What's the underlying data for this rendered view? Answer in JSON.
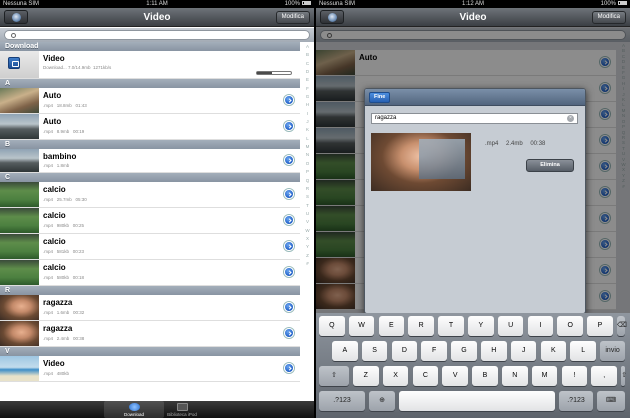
{
  "status": {
    "carrier": "Nessuna SIM",
    "time": "1:11 AM",
    "battery": "100%"
  },
  "status_right": {
    "carrier": "Nessuna SIM",
    "time": "1:12 AM",
    "battery": "100%"
  },
  "navbar": {
    "title": "Video",
    "edit_label": "Modifica"
  },
  "navbar_right": {
    "title": "Video",
    "edit_label": "Modifica"
  },
  "search": {
    "value": ""
  },
  "sections": {
    "download": "Download",
    "a": "A",
    "b": "B",
    "c": "C",
    "r": "R",
    "v": "V"
  },
  "rows": [
    {
      "title": "Video",
      "sub": "Download... 7.0/14.9mb  1271kb/s",
      "progress": 0.45
    },
    {
      "title": "Auto",
      "sub": ".mp4   18.8mb   01:43"
    },
    {
      "title": "Auto",
      "sub": ".mp4   8.9mb   00:19"
    },
    {
      "title": "bambino",
      "sub": ".mp4   1.8mb"
    },
    {
      "title": "calcio",
      "sub": ".mp4   25.7mb   05:30"
    },
    {
      "title": "calcio",
      "sub": ".mp4   980kb   00:25"
    },
    {
      "title": "calcio",
      "sub": ".mp4   581kb   00:23"
    },
    {
      "title": "calcio",
      "sub": ".mp4   580kb   00:18"
    },
    {
      "title": "ragazza",
      "sub": ".mp4   1.6mb   00:32"
    },
    {
      "title": "ragazza",
      "sub": ".mp4   2.4mb   00:38"
    },
    {
      "title": "Video",
      "sub": ".mp4   480kb"
    }
  ],
  "index_letters": [
    "A",
    "B",
    "C",
    "D",
    "E",
    "F",
    "G",
    "H",
    "I",
    "J",
    "K",
    "L",
    "M",
    "N",
    "O",
    "P",
    "Q",
    "R",
    "S",
    "T",
    "U",
    "V",
    "W",
    "X",
    "Y",
    "Z",
    "#"
  ],
  "tabs": {
    "download": "Download",
    "library": "Biblioteca iPod"
  },
  "popover": {
    "done_label": "Fine",
    "name_value": "ragazza",
    "meta": ".mp4   2.4mb   00:38",
    "delete_label": "Elimina"
  },
  "right_list": {
    "auto": "Auto"
  },
  "keyboard": {
    "row1": [
      "Q",
      "W",
      "E",
      "R",
      "T",
      "Y",
      "U",
      "I",
      "O",
      "P"
    ],
    "row2": [
      "A",
      "S",
      "D",
      "F",
      "G",
      "H",
      "J",
      "K",
      "L"
    ],
    "row3": [
      "Z",
      "X",
      "C",
      "V",
      "B",
      "N",
      "M",
      "!",
      ","
    ],
    "return_label": "invio",
    "numbers_label": ".?123",
    "shift_symbol": "⇧",
    "globe_symbol": "⊕",
    "backspace_symbol": "⌫",
    "hide_symbol": "⌨"
  }
}
